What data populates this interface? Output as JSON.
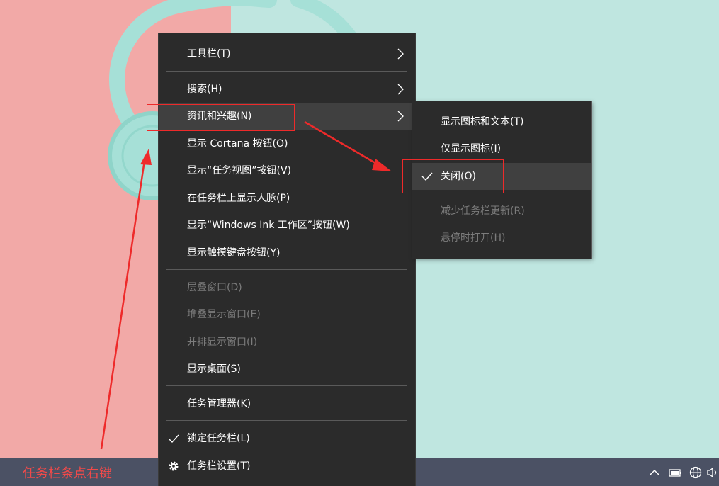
{
  "menu": {
    "items": [
      {
        "label": "工具栏(T)",
        "submenu": true,
        "enabled": true
      },
      {
        "label": "搜索(H)",
        "submenu": true,
        "enabled": true
      },
      {
        "label": "资讯和兴趣(N)",
        "submenu": true,
        "enabled": true,
        "highlighted": true
      },
      {
        "label": "显示 Cortana 按钮(O)",
        "enabled": true
      },
      {
        "label": "显示“任务视图”按钮(V)",
        "enabled": true
      },
      {
        "label": "在任务栏上显示人脉(P)",
        "enabled": true
      },
      {
        "label": "显示“Windows Ink 工作区”按钮(W)",
        "enabled": true
      },
      {
        "label": "显示触摸键盘按钮(Y)",
        "enabled": true
      },
      {
        "label": "层叠窗口(D)",
        "enabled": false
      },
      {
        "label": "堆叠显示窗口(E)",
        "enabled": false
      },
      {
        "label": "并排显示窗口(I)",
        "enabled": false
      },
      {
        "label": "显示桌面(S)",
        "enabled": true
      },
      {
        "label": "任务管理器(K)",
        "enabled": true
      },
      {
        "label": "锁定任务栏(L)",
        "enabled": true,
        "checked": true
      },
      {
        "label": "任务栏设置(T)",
        "enabled": true,
        "icon": "gear-icon"
      }
    ]
  },
  "submenu": {
    "items": [
      {
        "label": "显示图标和文本(T)",
        "enabled": true
      },
      {
        "label": "仅显示图标(I)",
        "enabled": true
      },
      {
        "label": "关闭(O)",
        "enabled": true,
        "checked": true,
        "highlighted": true
      },
      {
        "label": "减少任务栏更新(R)",
        "enabled": false
      },
      {
        "label": "悬停时打开(H)",
        "enabled": false
      }
    ]
  },
  "annotation": {
    "label": "任务栏条点右键",
    "color": "#ee2a2a"
  },
  "tray": {
    "icons": [
      "chevron-up-icon",
      "battery-icon",
      "globe-icon",
      "speaker-icon"
    ]
  },
  "colors": {
    "menu_bg": "#2b2b2b",
    "taskbar": "#4b5164",
    "wallpaper_pink": "#f2a9a7",
    "wallpaper_mint": "#bfe6e0"
  }
}
